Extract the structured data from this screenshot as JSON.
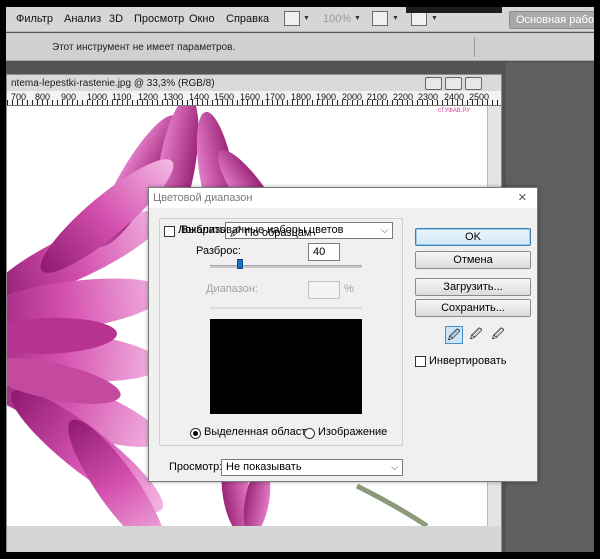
{
  "menubar": {
    "items": [
      "Фильтр",
      "Анализ",
      "3D",
      "Просмотр",
      "Окно",
      "Справка"
    ],
    "zoom": "100%",
    "workspace": "Основная рабоч"
  },
  "options_bar": {
    "text": "Этот инструмент не имеет параметров."
  },
  "document": {
    "title": "ntema-lepestki-rastenie.jpg @ 33,3% (RGB/8)",
    "ruler_labels": [
      "700",
      "800",
      "900",
      "1000",
      "1100",
      "1200",
      "1300",
      "1400",
      "1500",
      "1600",
      "1700",
      "1800",
      "1900",
      "2000",
      "2100",
      "2200",
      "2300",
      "2400",
      "2500"
    ],
    "watermark": "сТУФАВ.РУ"
  },
  "dialog": {
    "title": "Цветовой диапазон",
    "select_label": "Выбрать:",
    "select_value": "По образцам",
    "localized_label": "Локализованные наборы цветов",
    "localized_checked": false,
    "fuzziness_label": "Разброс:",
    "fuzziness_value": "40",
    "range_label": "Диапазон:",
    "range_value": "",
    "percent": "%",
    "radio_selection": "Выделенная область",
    "radio_image": "Изображение",
    "selected_radio": "selection",
    "preview_label": "Просмотр:",
    "preview_value": "Не показывать",
    "buttons": {
      "ok": "OK",
      "cancel": "Отмена",
      "load": "Загрузить...",
      "save": "Сохранить..."
    },
    "invert_label": "Инвертировать",
    "invert_checked": false,
    "fuzziness_level": 0.2
  },
  "colors": {
    "flower": "#c23a9a",
    "dialog_bg": "#f0f0f0",
    "accent": "#3c7fb1"
  }
}
